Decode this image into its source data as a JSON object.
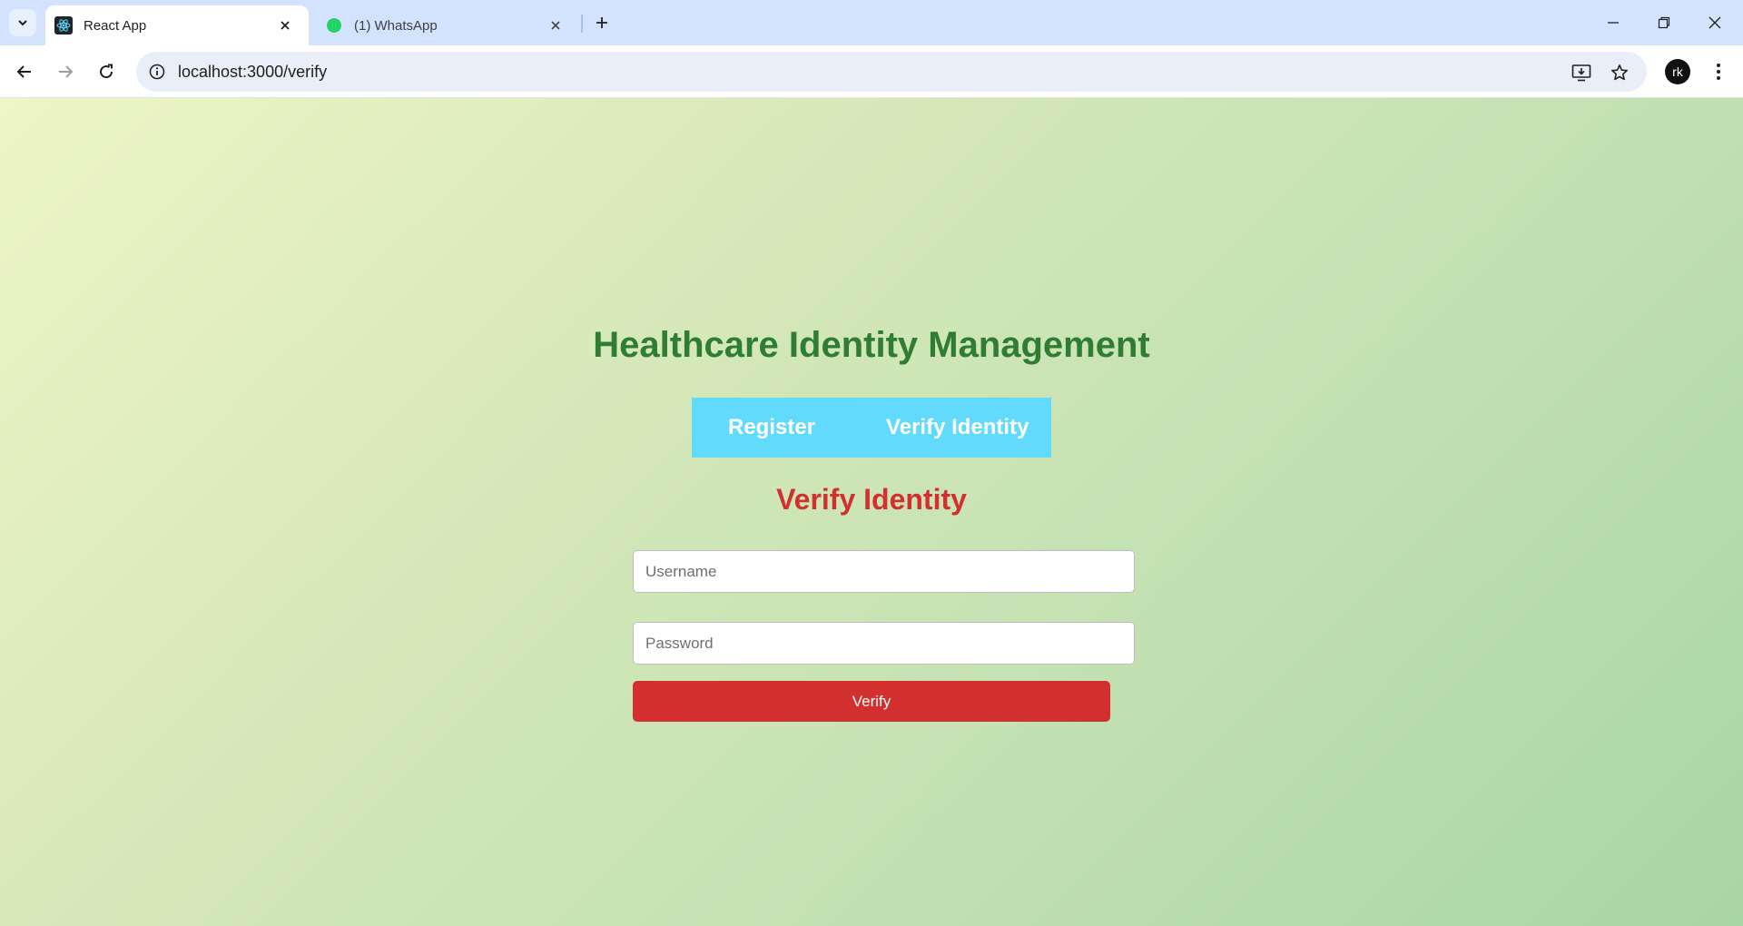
{
  "browser": {
    "tabs": [
      {
        "title": "React App",
        "favicon": "react-icon",
        "active": true
      },
      {
        "title": "(1) WhatsApp",
        "favicon": "whatsapp-icon",
        "active": false,
        "badge": "1"
      }
    ],
    "url": "localhost:3000/verify",
    "profile_initials": "rk"
  },
  "page": {
    "app_title": "Healthcare Identity Management",
    "nav": {
      "register_label": "Register",
      "verify_label": "Verify Identity"
    },
    "section_title": "Verify Identity",
    "form": {
      "username_placeholder": "Username",
      "username_value": "",
      "password_placeholder": "Password",
      "password_value": "",
      "submit_label": "Verify"
    }
  },
  "colors": {
    "title": "#2e7d32",
    "nav_bg": "#61dafb",
    "section_title": "#d32f2f",
    "button": "#d32f2f"
  }
}
